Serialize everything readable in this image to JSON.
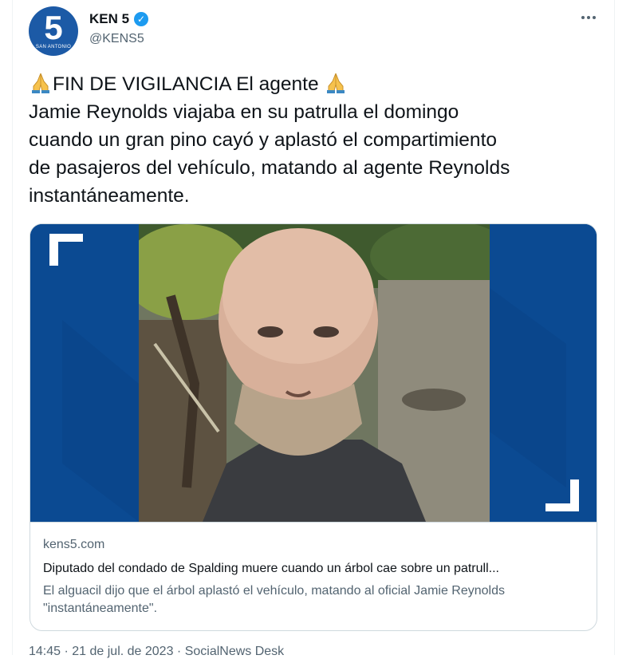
{
  "author": {
    "display_name": "KEN 5",
    "handle": "@KENS5",
    "avatar_number": "5",
    "avatar_subtext": "SAN ANTONIO",
    "verified": true
  },
  "tweet": {
    "lines": [
      "FIN DE VIGILANCIA El agente",
      "Jamie Reynolds viajaba en su patrulla el domingo",
      "cuando un gran pino cayó y aplastó el compartimiento",
      "de pasajeros del vehículo, matando al agente Reynolds",
      "instantáneamente."
    ],
    "emoji_icon": "folded-hands-icon"
  },
  "link_card": {
    "domain": "kens5.com",
    "title": "Diputado del condado de Spalding muere cuando un árbol cae sobre un patrull...",
    "description": "El alguacil dijo que el árbol aplastó el vehículo, matando al oficial Jamie Reynolds \"instantáneamente\"."
  },
  "timestamp_partial": "14:45 · 21 de jul. de 2023 · SocialNews Desk",
  "colors": {
    "brand_blue": "#0b4a92",
    "verified_blue": "#1d9bf0",
    "text_primary": "#0f1419",
    "text_secondary": "#536471"
  }
}
